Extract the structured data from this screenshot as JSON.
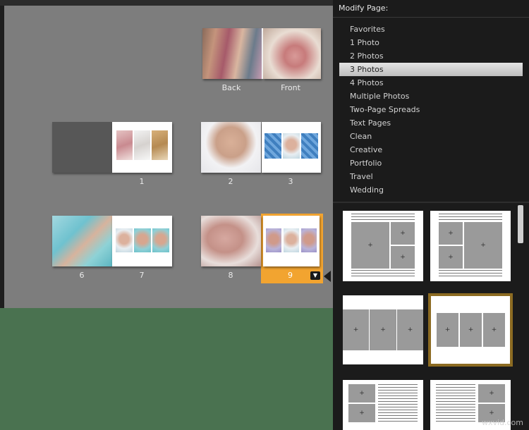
{
  "panel": {
    "title": "Modify Page:",
    "categories": [
      {
        "label": "Favorites",
        "selected": false
      },
      {
        "label": "1 Photo",
        "selected": false
      },
      {
        "label": "2 Photos",
        "selected": false
      },
      {
        "label": "3 Photos",
        "selected": true
      },
      {
        "label": "4 Photos",
        "selected": false
      },
      {
        "label": "Multiple Photos",
        "selected": false
      },
      {
        "label": "Two-Page Spreads",
        "selected": false
      },
      {
        "label": "Text Pages",
        "selected": false
      },
      {
        "label": "Clean",
        "selected": false
      },
      {
        "label": "Creative",
        "selected": false
      },
      {
        "label": "Portfolio",
        "selected": false
      },
      {
        "label": "Travel",
        "selected": false
      },
      {
        "label": "Wedding",
        "selected": false
      }
    ],
    "placeholder_mark": "+",
    "selected_template_index": 3
  },
  "canvas": {
    "cover": {
      "back": "Back",
      "front": "Front"
    },
    "page_labels": [
      "1",
      "2",
      "3",
      "6",
      "7",
      "8",
      "9"
    ],
    "selected_page": "9",
    "dropdown_icon": "chevron-down-icon"
  },
  "colors": {
    "selection": "#f2a430",
    "template_selection": "#8c6b22"
  },
  "watermark": "wxvid.com"
}
